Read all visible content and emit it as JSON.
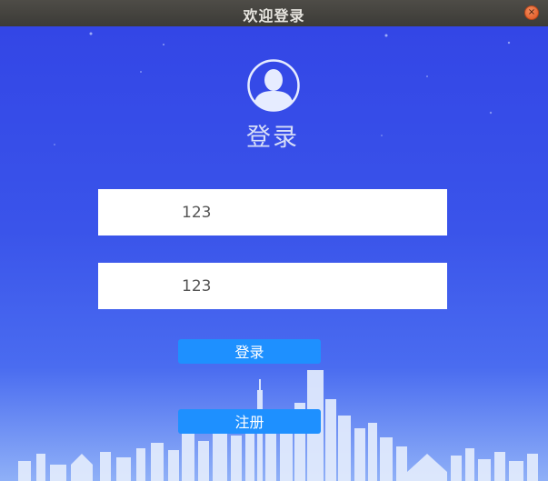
{
  "window": {
    "title": "欢迎登录",
    "close_symbol": "×"
  },
  "header": {
    "heading": "登录",
    "avatar_icon": "user-avatar-icon"
  },
  "form": {
    "username_value": "123",
    "password_value": "123"
  },
  "buttons": {
    "login_label": "登录",
    "register_label": "注册"
  },
  "colors": {
    "background_top": "#3346e6",
    "background_bottom": "#8fb0f7",
    "button": "#1e90ff",
    "titlebar": "#3c3b37",
    "close_button": "#e0531d"
  }
}
